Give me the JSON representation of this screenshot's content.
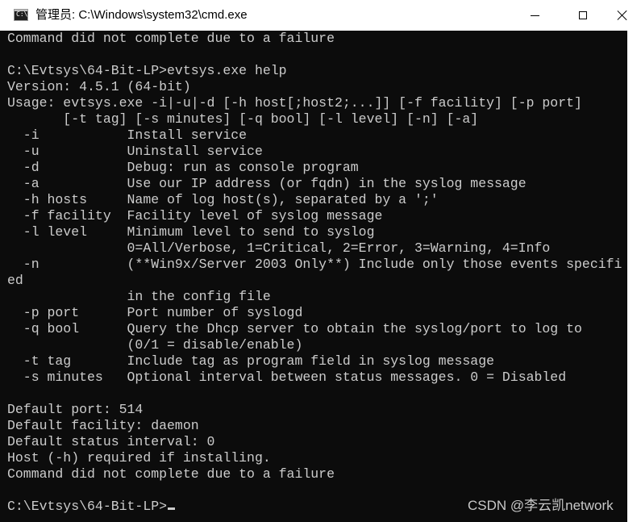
{
  "window": {
    "icon_text": "C:\\",
    "title": "管理员: C:\\Windows\\system32\\cmd.exe",
    "buttons": {
      "minimize": "minimize",
      "maximize": "maximize",
      "close": "close"
    }
  },
  "console": {
    "lines": [
      "Command did not complete due to a failure",
      "",
      "C:\\Evtsys\\64-Bit-LP>evtsys.exe help",
      "Version: 4.5.1 (64-bit)",
      "Usage: evtsys.exe -i|-u|-d [-h host[;host2;...]] [-f facility] [-p port]",
      "       [-t tag] [-s minutes] [-q bool] [-l level] [-n] [-a]",
      "  -i           Install service",
      "  -u           Uninstall service",
      "  -d           Debug: run as console program",
      "  -a           Use our IP address (or fqdn) in the syslog message",
      "  -h hosts     Name of log host(s), separated by a ';'",
      "  -f facility  Facility level of syslog message",
      "  -l level     Minimum level to send to syslog",
      "               0=All/Verbose, 1=Critical, 2=Error, 3=Warning, 4=Info",
      "  -n           (**Win9x/Server 2003 Only**) Include only those events specifi",
      "ed",
      "               in the config file",
      "  -p port      Port number of syslogd",
      "  -q bool      Query the Dhcp server to obtain the syslog/port to log to",
      "               (0/1 = disable/enable)",
      "  -t tag       Include tag as program field in syslog message",
      "  -s minutes   Optional interval between status messages. 0 = Disabled",
      "",
      "Default port: 514",
      "Default facility: daemon",
      "Default status interval: 0",
      "Host (-h) required if installing.",
      "Command did not complete due to a failure",
      "",
      "C:\\Evtsys\\64-Bit-LP>"
    ]
  },
  "watermark": "CSDN @李云凯network",
  "colors": {
    "console_bg": "#0c0c0c",
    "console_fg": "#cccccc",
    "titlebar_bg": "#ffffff"
  },
  "icons": [
    "cmd-app-icon",
    "minimize-icon",
    "maximize-icon",
    "close-icon"
  ]
}
